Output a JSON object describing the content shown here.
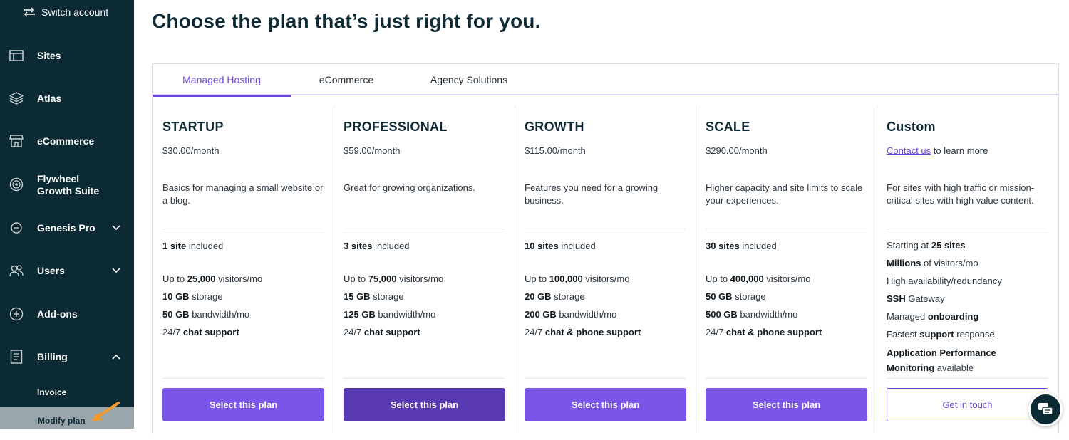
{
  "sidebar": {
    "switch_label": "Switch account",
    "items": [
      {
        "label": "Sites",
        "icon": "sites-icon"
      },
      {
        "label": "Atlas",
        "icon": "layers-icon"
      },
      {
        "label": "eCommerce",
        "icon": "store-icon"
      },
      {
        "label": "Flywheel\nGrowth Suite",
        "icon": "growth-icon"
      },
      {
        "label": "Genesis Pro",
        "icon": "genesis-icon"
      },
      {
        "label": "Users",
        "icon": "users-icon"
      },
      {
        "label": "Add-ons",
        "icon": "plus-circle-icon"
      },
      {
        "label": "Billing",
        "icon": "billing-icon"
      }
    ],
    "billing_sub": {
      "invoice": "Invoice",
      "modify_plan": "Modify plan"
    }
  },
  "page": {
    "title": "Choose the plan that’s just right for you."
  },
  "tabs": [
    {
      "label": "Managed Hosting",
      "active": true
    },
    {
      "label": "eCommerce",
      "active": false
    },
    {
      "label": "Agency Solutions",
      "active": false
    }
  ],
  "plans": [
    {
      "name": "STARTUP",
      "price": "$30.00/month",
      "desc": "Basics for managing a small website or a blog.",
      "sites_bold": "1 site",
      "sites_rest": " included",
      "visitors_pre": "Up to ",
      "visitors_bold": "25,000",
      "visitors_rest": " visitors/mo",
      "storage_bold": "10 GB",
      "storage_rest": " storage",
      "bandwidth_bold": "50 GB",
      "bandwidth_rest": " bandwidth/mo",
      "support_pre": "24/7 ",
      "support_bold": "chat support",
      "button": "Select this plan"
    },
    {
      "name": "PROFESSIONAL",
      "price": "$59.00/month",
      "desc": "Great for growing organizations.",
      "sites_bold": "3 sites",
      "sites_rest": " included",
      "visitors_pre": "Up to ",
      "visitors_bold": "75,000",
      "visitors_rest": " visitors/mo",
      "storage_bold": "15 GB",
      "storage_rest": " storage",
      "bandwidth_bold": "125 GB",
      "bandwidth_rest": " bandwidth/mo",
      "support_pre": "24/7 ",
      "support_bold": "chat support",
      "button": "Select this plan"
    },
    {
      "name": "GROWTH",
      "price": "$115.00/month",
      "desc": "Features you need for a growing business.",
      "sites_bold": "10 sites",
      "sites_rest": " included",
      "visitors_pre": "Up to ",
      "visitors_bold": "100,000",
      "visitors_rest": " visitors/mo",
      "storage_bold": "20 GB",
      "storage_rest": " storage",
      "bandwidth_bold": "200 GB",
      "bandwidth_rest": " bandwidth/mo",
      "support_pre": "24/7 ",
      "support_bold": "chat & phone support",
      "button": "Select this plan"
    },
    {
      "name": "SCALE",
      "price": "$290.00/month",
      "desc": "Higher capacity and site limits to scale your experiences.",
      "sites_bold": "30 sites",
      "sites_rest": " included",
      "visitors_pre": "Up to ",
      "visitors_bold": "400,000",
      "visitors_rest": " visitors/mo",
      "storage_bold": "50 GB",
      "storage_rest": " storage",
      "bandwidth_bold": "500 GB",
      "bandwidth_rest": " bandwidth/mo",
      "support_pre": "24/7 ",
      "support_bold": "chat & phone support",
      "button": "Select this plan"
    }
  ],
  "custom": {
    "name": "Custom",
    "contact_link": "Contact us",
    "contact_rest": " to learn more",
    "desc": "For sites with high traffic or mission-critical sites with high value content.",
    "f1_pre": "Starting at ",
    "f1_bold": "25 sites",
    "f2_bold": "Millions",
    "f2_rest": " of visitors/mo",
    "f3": "High availability/redundancy",
    "f4_bold": "SSH",
    "f4_rest": " Gateway",
    "f5_pre": "Managed ",
    "f5_bold": "onboarding",
    "f6_pre": "Fastest ",
    "f6_bold": "support",
    "f6_rest": " response",
    "f7_bold": "Application Performance Monitoring",
    "f7_rest": " available",
    "button": "Get in touch"
  },
  "colors": {
    "sidebar_bg": "#0b2a33",
    "accent": "#6c47d6",
    "button": "#7a55e8",
    "button_hover": "#5a3ab3"
  }
}
